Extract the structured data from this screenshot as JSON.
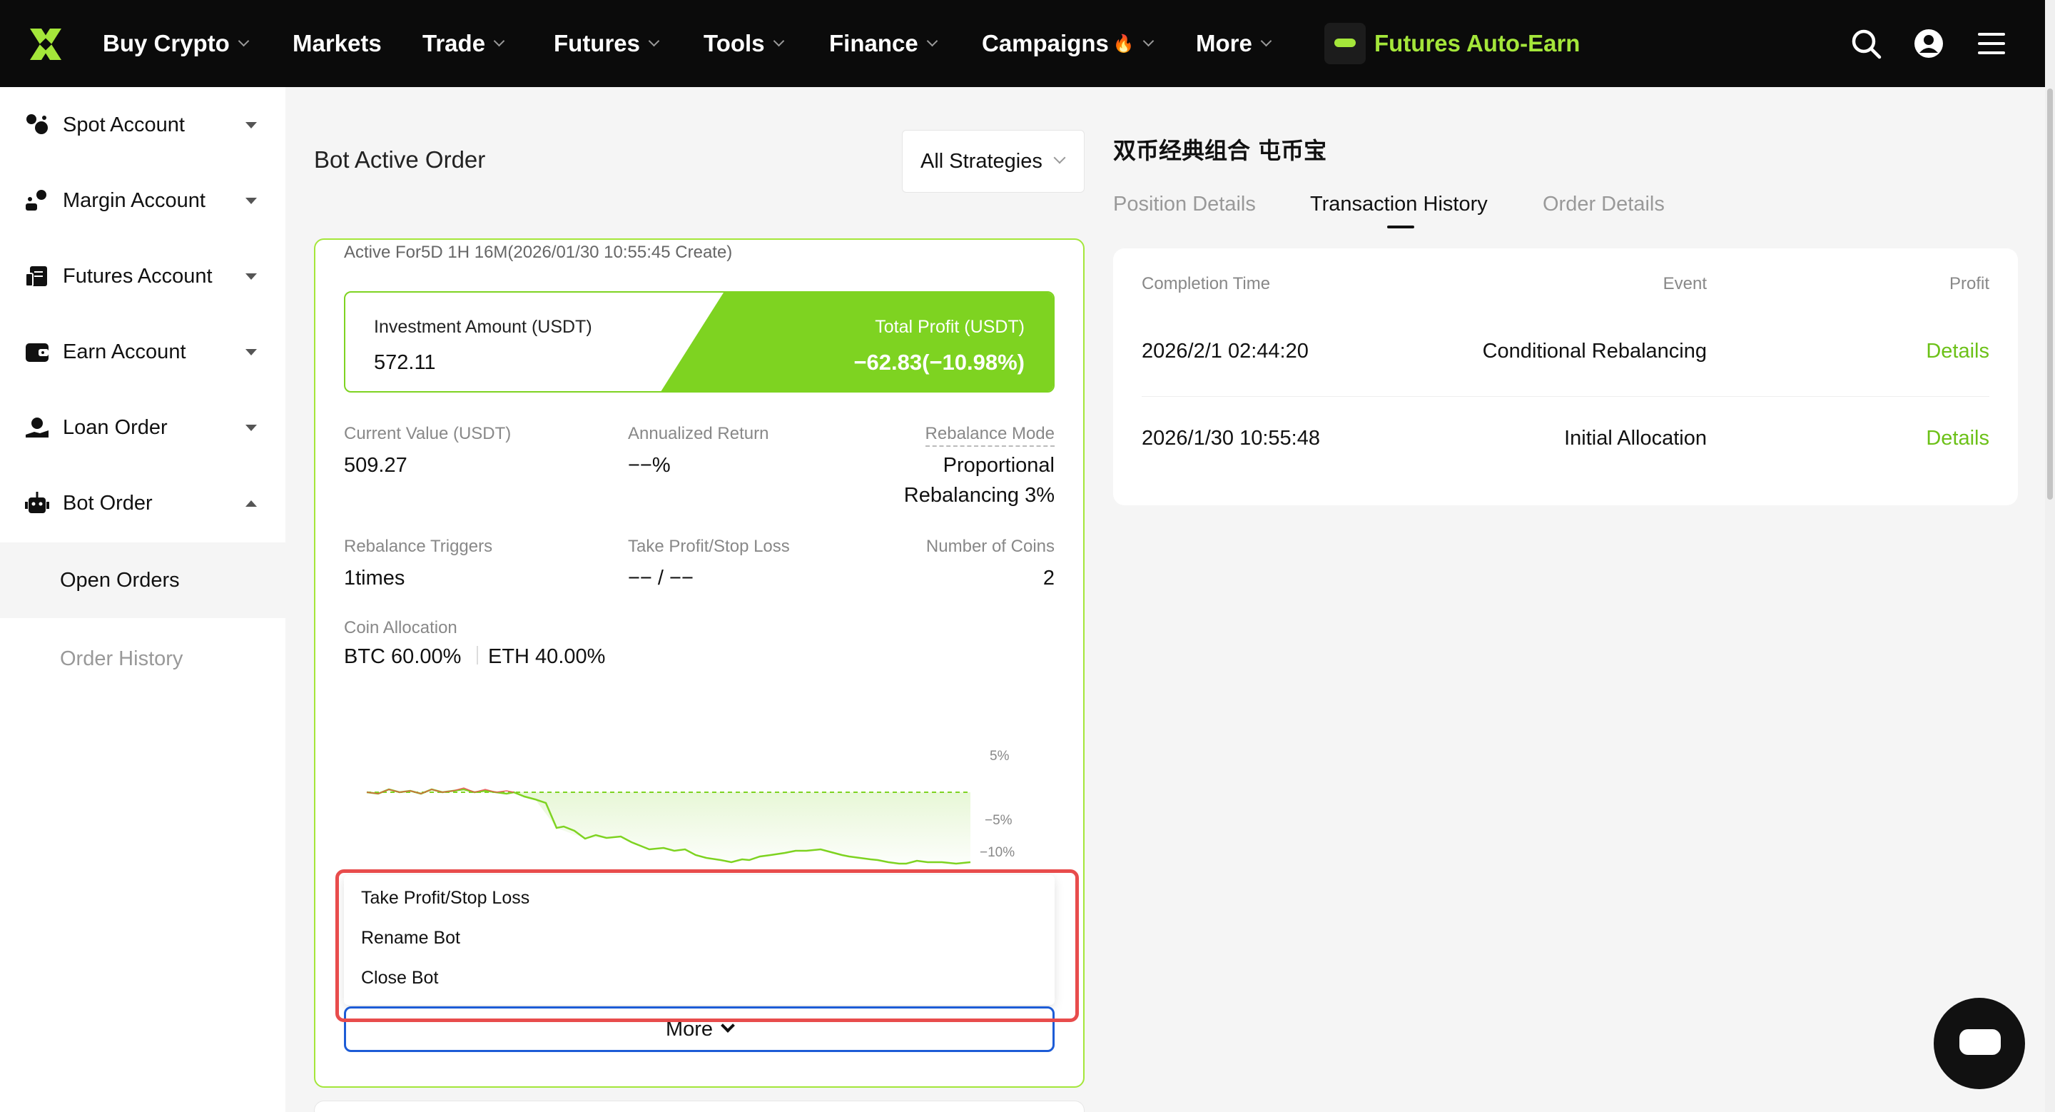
{
  "nav": {
    "items": [
      {
        "label": "Buy Crypto",
        "dropdown": true
      },
      {
        "label": "Markets",
        "dropdown": false
      },
      {
        "label": "Trade",
        "dropdown": true
      },
      {
        "label": "Futures",
        "dropdown": true
      },
      {
        "label": "Tools",
        "dropdown": true
      },
      {
        "label": "Finance",
        "dropdown": true
      },
      {
        "label": "Campaigns",
        "dropdown": true,
        "badge": "🔥"
      },
      {
        "label": "More",
        "dropdown": true
      }
    ],
    "promo_label": "Futures Auto-Earn",
    "icons": [
      "search-icon",
      "account-icon",
      "menu-icon"
    ],
    "accent_color": "#a4e63a"
  },
  "sidebar": {
    "items": [
      {
        "label": "Spot Account",
        "icon": "spot-account-icon",
        "expanded": false
      },
      {
        "label": "Margin Account",
        "icon": "margin-account-icon",
        "expanded": false
      },
      {
        "label": "Futures Account",
        "icon": "futures-account-icon",
        "expanded": false
      },
      {
        "label": "Earn Account",
        "icon": "earn-account-icon",
        "expanded": false
      },
      {
        "label": "Loan Order",
        "icon": "loan-order-icon",
        "expanded": false
      },
      {
        "label": "Bot Order",
        "icon": "bot-icon",
        "expanded": true
      }
    ],
    "sub_items": [
      {
        "label": "Open Orders",
        "active": true
      },
      {
        "label": "Order History",
        "active": false
      }
    ]
  },
  "main": {
    "title": "Bot Active Order",
    "strategy_select": "All Strategies",
    "card": {
      "active_for": "Active For5D 1H 16M(2026/01/30 10:55:45 Create)",
      "investment_label": "Investment Amount (USDT)",
      "investment_value": "572.11",
      "total_profit_label": "Total Profit (USDT)",
      "total_profit_value": "−62.83(−10.98%)",
      "current_value_label": "Current Value (USDT)",
      "current_value": "509.27",
      "annualized_label": "Annualized Return",
      "annualized_value": "−−%",
      "rebalance_mode_label": "Rebalance Mode",
      "rebalance_mode_line1": "Proportional",
      "rebalance_mode_line2": "Rebalancing 3%",
      "triggers_label": "Rebalance Triggers",
      "triggers_value": "1times",
      "tpsl_label": "Take Profit/Stop Loss",
      "tpsl_value": "−− / −−",
      "coins_label": "Number of Coins",
      "coins_value": "2",
      "allocation_label": "Coin Allocation",
      "allocation": [
        "BTC 60.00%",
        "ETH 40.00%"
      ],
      "chart_ticks": [
        "5%",
        "−5%",
        "−10%"
      ],
      "menu": [
        "Take Profit/Stop Loss",
        "Rename Bot",
        "Close Bot"
      ],
      "more_label": "More"
    }
  },
  "detail": {
    "title": "双币经典组合 屯币宝",
    "tabs": [
      {
        "label": "Position Details",
        "active": false
      },
      {
        "label": "Transaction History",
        "active": true
      },
      {
        "label": "Order Details",
        "active": false
      }
    ],
    "columns": [
      "Completion Time",
      "Event",
      "Profit"
    ],
    "rows": [
      {
        "time": "2026/2/1 02:44:20",
        "event": "Conditional Rebalancing",
        "profit": "Details"
      },
      {
        "time": "2026/1/30 10:55:48",
        "event": "Initial Allocation",
        "profit": "Details"
      }
    ],
    "link_color": "#6cc118"
  }
}
